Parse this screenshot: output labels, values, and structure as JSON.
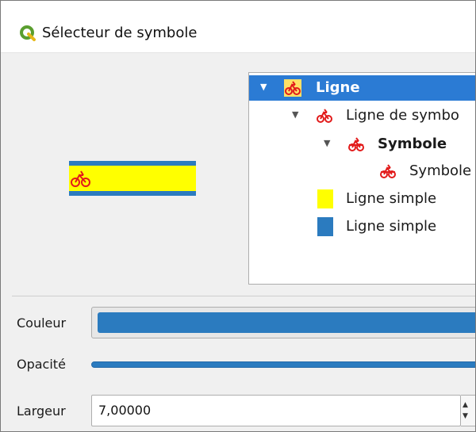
{
  "window": {
    "title": "Sélecteur de symbole",
    "app_icon": "qgis-logo-icon"
  },
  "preview": {
    "fill_color": "#ffff00",
    "border_color": "#2b7bbf",
    "marker_icon": "bicycle-icon",
    "marker_color": "#e21b1b"
  },
  "layer_tree": {
    "items": [
      {
        "label": "Ligne",
        "level": 0,
        "expanded": true,
        "selected": true,
        "bold": true,
        "icon": "bicycle-icon"
      },
      {
        "label": "Ligne de symbo",
        "level": 1,
        "expanded": true,
        "selected": false,
        "bold": false,
        "icon": "bicycle-icon"
      },
      {
        "label": "Symbole",
        "level": 2,
        "expanded": true,
        "selected": false,
        "bold": true,
        "icon": "bicycle-icon"
      },
      {
        "label": "Symbole",
        "level": 3,
        "expanded": false,
        "selected": false,
        "bold": false,
        "icon": "bicycle-icon"
      },
      {
        "label": "Ligne simple",
        "level": 1,
        "expanded": false,
        "selected": false,
        "bold": false,
        "swatch": "#ffff00"
      },
      {
        "label": "Ligne simple",
        "level": 1,
        "expanded": false,
        "selected": false,
        "bold": false,
        "swatch": "#2b7bbf"
      }
    ]
  },
  "properties": {
    "color_label": "Couleur",
    "color_value": "#2b7bbf",
    "opacity_label": "Opacité",
    "opacity_percent": 100,
    "width_label": "Largeur",
    "width_value": "7,00000"
  },
  "colors": {
    "selection": "#2b7bd4",
    "accent_red": "#e21b1b"
  }
}
